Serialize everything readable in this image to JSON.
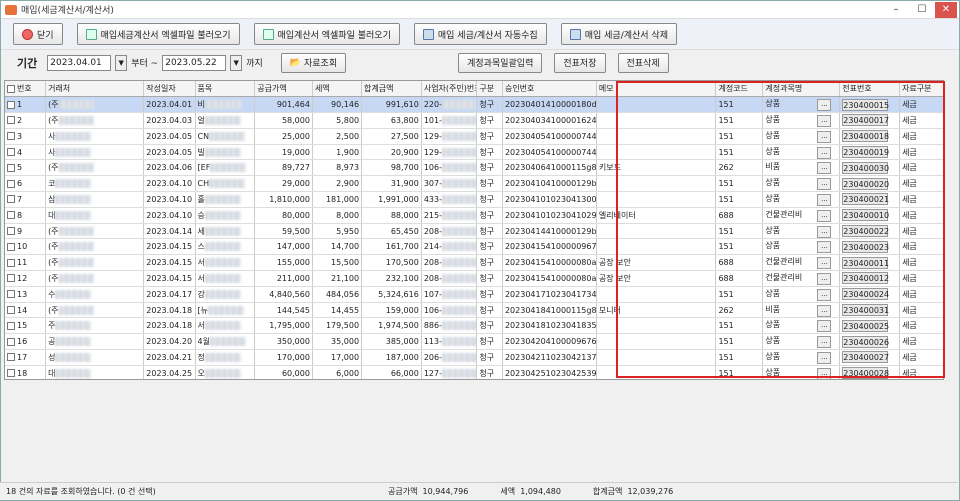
{
  "window": {
    "title": "매입(세금계산서/계산서)"
  },
  "toolbar": {
    "close": "닫기",
    "tax_excel": "매입세금계산서 엑셀파일 불러오기",
    "bill_excel": "매입계산서 엑셀파일 불러오기",
    "auto_collect": "매입 세금/계산서 자동수집",
    "delete": "매입 세금/계산서 삭제"
  },
  "filter": {
    "period_label": "기간",
    "from": "2023.04.01",
    "from_suffix": "부터 ~",
    "to": "2023.05.22",
    "to_suffix": "까지",
    "search": "자료조회",
    "bulk_account": "계정과목일괄입력",
    "save_voucher": "전표저장",
    "delete_voucher": "전표삭제"
  },
  "columns": [
    "번호",
    "거래처",
    "작성일자",
    "품목",
    "공급가액",
    "세액",
    "합계금액",
    "사업자(주민)번호",
    "구분",
    "승인번호",
    "메모",
    "계정코드",
    "계정과목명",
    "전표번호",
    "자료구분"
  ],
  "rows": [
    [
      "1",
      "(주",
      "2023.04.01",
      "비",
      "901,464",
      "90,146",
      "991,610",
      "220-",
      "청구",
      "20230401410000180da0",
      "",
      "151",
      "상품",
      "230400015",
      "세금"
    ],
    [
      "2",
      "(주",
      "2023.04.03",
      "얼",
      "58,000",
      "5,800",
      "63,800",
      "101-",
      "청구",
      "20230403410000162426",
      "",
      "151",
      "상품",
      "230400017",
      "세금"
    ],
    [
      "3",
      "사",
      "2023.04.05",
      "CN",
      "25,000",
      "2,500",
      "27,500",
      "129-",
      "청구",
      "20230405410000074416",
      "",
      "151",
      "상품",
      "230400018",
      "세금"
    ],
    [
      "4",
      "사",
      "2023.04.05",
      "빌",
      "19,000",
      "1,900",
      "20,900",
      "129-",
      "청구",
      "20230405410000074415",
      "",
      "151",
      "상품",
      "230400019",
      "세금"
    ],
    [
      "5",
      "(주",
      "2023.04.06",
      "[EF",
      "89,727",
      "8,973",
      "98,700",
      "106-",
      "청구",
      "2023040641000115g81a",
      "키보드",
      "262",
      "비품",
      "230400030",
      "세금"
    ],
    [
      "6",
      "코",
      "2023.04.10",
      "CH",
      "29,000",
      "2,900",
      "31,900",
      "307-",
      "청구",
      "20230410410000129b11",
      "",
      "151",
      "상품",
      "230400020",
      "세금"
    ],
    [
      "7",
      "삼",
      "2023.04.10",
      "홀",
      "1,810,000",
      "181,000",
      "1,991,000",
      "433-",
      "청구",
      "20230410102304130007",
      "",
      "151",
      "상품",
      "230400021",
      "세금"
    ],
    [
      "8",
      "대",
      "2023.04.10",
      "승",
      "80,000",
      "8,000",
      "88,000",
      "215-",
      "청구",
      "20230410102304102995",
      "엘리베이터",
      "688",
      "건물관리비",
      "230400010",
      "세금"
    ],
    [
      "9",
      "(주",
      "2023.04.14",
      "세",
      "59,500",
      "5,950",
      "65,450",
      "208-",
      "청구",
      "20230414410000129b50",
      "",
      "151",
      "상품",
      "230400022",
      "세금"
    ],
    [
      "10",
      "(주",
      "2023.04.15",
      "스",
      "147,000",
      "14,700",
      "161,700",
      "214-",
      "청구",
      "20230415410000096759",
      "",
      "151",
      "상품",
      "230400023",
      "세금"
    ],
    [
      "11",
      "(주",
      "2023.04.15",
      "서",
      "155,000",
      "15,500",
      "170,500",
      "208-",
      "청구",
      "20230415410000080a0",
      "공장 보안",
      "688",
      "건물관리비",
      "230400011",
      "세금"
    ],
    [
      "12",
      "(주",
      "2023.04.15",
      "서",
      "211,000",
      "21,100",
      "232,100",
      "208-",
      "청구",
      "20230415410000080a0",
      "공장 보안",
      "688",
      "건물관리비",
      "230400012",
      "세금"
    ],
    [
      "13",
      "수",
      "2023.04.17",
      "강",
      "4,840,560",
      "484,056",
      "5,324,616",
      "107-",
      "청구",
      "20230417102304173464",
      "",
      "151",
      "상품",
      "230400024",
      "세금"
    ],
    [
      "14",
      "(주",
      "2023.04.18",
      "[뉴",
      "144,545",
      "14,455",
      "159,000",
      "106-",
      "청구",
      "2023041841000115g81a",
      "모니터",
      "262",
      "비품",
      "230400031",
      "세금"
    ],
    [
      "15",
      "주",
      "2023.04.18",
      "서",
      "1,795,000",
      "179,500",
      "1,974,500",
      "886-",
      "청구",
      "20230418102304183534",
      "",
      "151",
      "상품",
      "230400025",
      "세금"
    ],
    [
      "16",
      "공",
      "2023.04.20",
      "4월",
      "350,000",
      "35,000",
      "385,000",
      "113-",
      "청구",
      "20230420410000967634",
      "",
      "151",
      "상품",
      "230400026",
      "세금"
    ],
    [
      "17",
      "성",
      "2023.04.21",
      "정",
      "170,000",
      "17,000",
      "187,000",
      "206-",
      "청구",
      "20230421102304213793",
      "",
      "151",
      "상품",
      "230400027",
      "세금"
    ],
    [
      "18",
      "대",
      "2023.04.25",
      "오",
      "60,000",
      "6,000",
      "66,000",
      "127-",
      "청구",
      "20230425102304253958",
      "",
      "151",
      "상품",
      "230400028",
      "세금"
    ]
  ],
  "status": {
    "message": "18 건의 자료를 조회하였습니다. (0 건 선택)",
    "supply_label": "공급가액",
    "supply_value": "10,944,796",
    "tax_label": "세액",
    "tax_value": "1,094,480",
    "total_label": "합계금액",
    "total_value": "12,039,276"
  }
}
